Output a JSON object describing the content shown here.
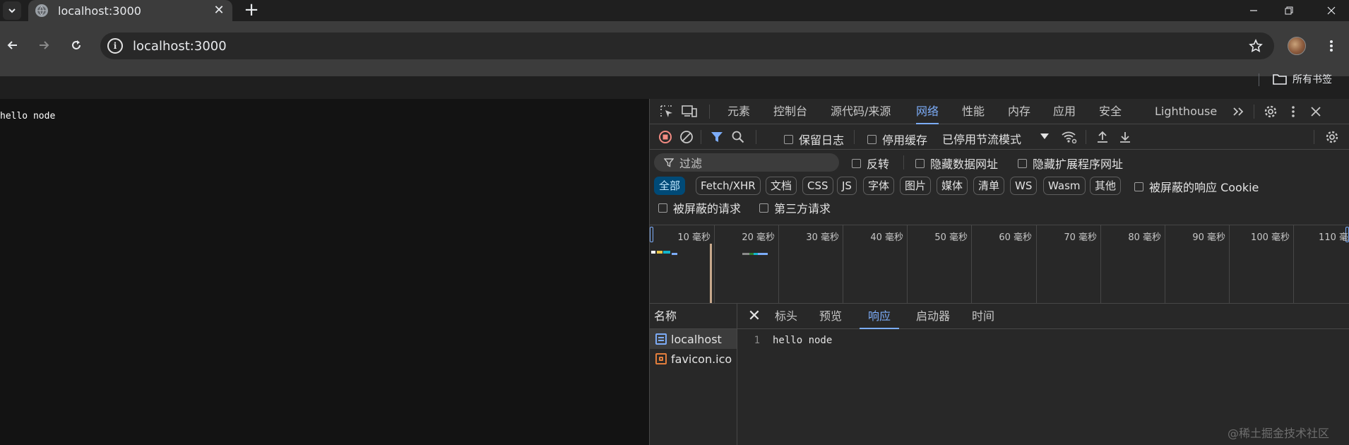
{
  "browser": {
    "tab_title": "localhost:3000",
    "url": "localhost:3000",
    "bookmarks_label": "所有书签"
  },
  "page": {
    "body_text": "hello node"
  },
  "devtools": {
    "tabs": [
      {
        "label": "元素"
      },
      {
        "label": "控制台"
      },
      {
        "label": "源代码/来源"
      },
      {
        "label": "网络",
        "active": true
      },
      {
        "label": "性能"
      },
      {
        "label": "内存"
      },
      {
        "label": "应用"
      },
      {
        "label": "安全"
      },
      {
        "label": "Lighthouse"
      }
    ],
    "network_toolbar": {
      "preserve_log": "保留日志",
      "disable_cache": "停用缓存",
      "throttling": "已停用节流模式"
    },
    "filter": {
      "placeholder": "过滤",
      "invert": "反转",
      "hide_data_urls": "隐藏数据网址",
      "hide_extension_urls": "隐藏扩展程序网址"
    },
    "type_filters": [
      "全部",
      "Fetch/XHR",
      "文档",
      "CSS",
      "JS",
      "字体",
      "图片",
      "媒体",
      "清单",
      "WS",
      "Wasm",
      "其他"
    ],
    "blocked_cookies": "被屏蔽的响应 Cookie",
    "blocked_requests": "被屏蔽的请求",
    "third_party": "第三方请求",
    "timeline_labels": [
      "10 毫秒",
      "20 毫秒",
      "30 毫秒",
      "40 毫秒",
      "50 毫秒",
      "60 毫秒",
      "70 毫秒",
      "80 毫秒",
      "90 毫秒",
      "100 毫秒",
      "110 毫"
    ],
    "request_list": {
      "header": "名称",
      "rows": [
        {
          "name": "localhost",
          "type": "document",
          "selected": true
        },
        {
          "name": "favicon.ico",
          "type": "image"
        }
      ]
    },
    "detail_tabs": [
      "标头",
      "预览",
      "响应",
      "启动器",
      "时间"
    ],
    "active_detail_tab": "响应",
    "response": {
      "line_number": "1",
      "line_text": "hello node"
    }
  },
  "watermark": "@稀土掘金技术社区"
}
